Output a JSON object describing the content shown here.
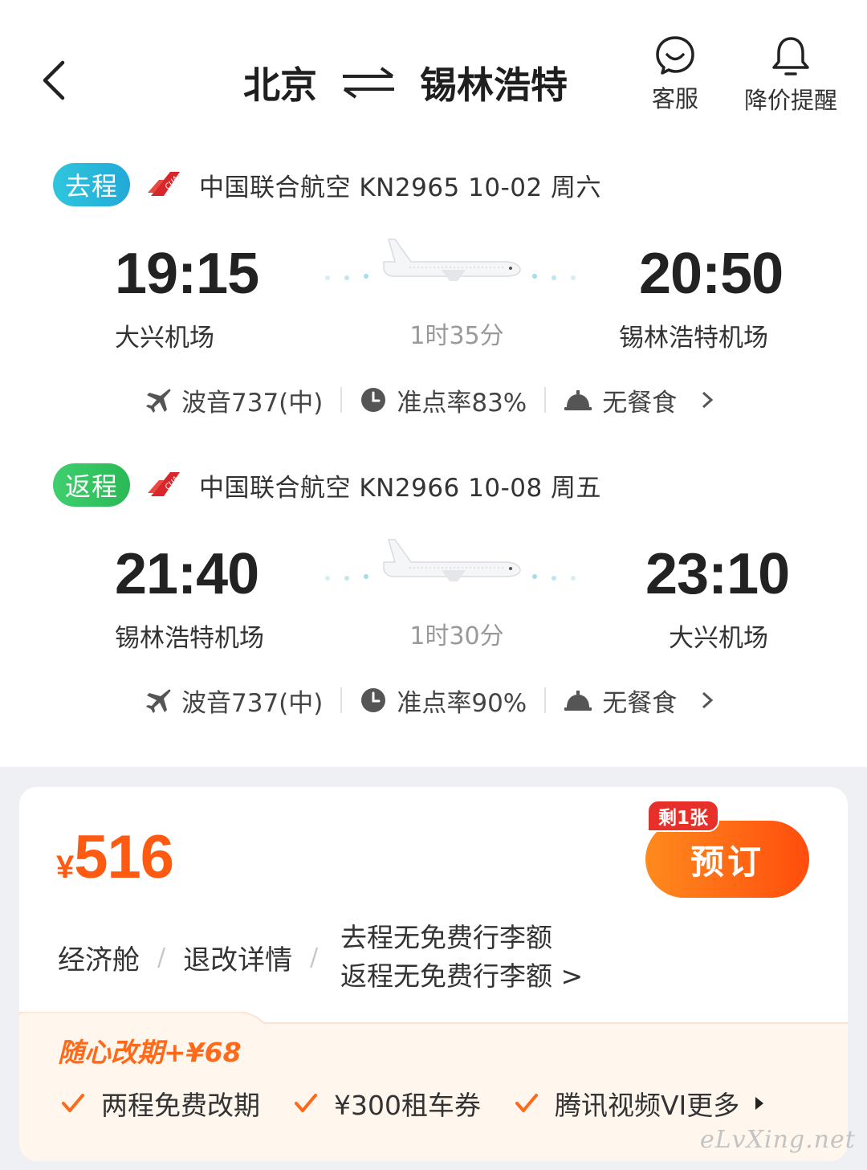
{
  "header": {
    "origin": "北京",
    "destination": "锡林浩特",
    "service_label": "客服",
    "alert_label": "降价提醒",
    "icons": [
      "back-icon",
      "swap-icon",
      "service-icon",
      "bell-icon"
    ]
  },
  "outbound": {
    "tag": "去程",
    "title": "中国联合航空 KN2965  10-02 周六",
    "dep_time": "19:15",
    "arr_time": "20:50",
    "dep_airport": "大兴机场",
    "arr_airport": "锡林浩特机场",
    "duration": "1时35分",
    "aircraft": "波音737(中)",
    "ontime": "准点率83%",
    "meal": "无餐食"
  },
  "return": {
    "tag": "返程",
    "title": "中国联合航空 KN2966  10-08 周五",
    "dep_time": "21:40",
    "arr_time": "23:10",
    "dep_airport": "锡林浩特机场",
    "arr_airport": "大兴机场",
    "duration": "1时30分",
    "aircraft": "波音737(中)",
    "ontime": "准点率90%",
    "meal": "无餐食"
  },
  "offer": {
    "currency": "¥",
    "price": "516",
    "remain_badge": "剩1张",
    "book_label": "预订",
    "cabin": "经济舱",
    "refund": "退改详情",
    "baggage_out": "去程无免费行李额",
    "baggage_ret": "返程无免费行李额 >",
    "promo_title": "随心改期+¥68",
    "perks": [
      "两程免费改期",
      "¥300租车券",
      "腾讯视频VI"
    ],
    "more_label": "更多"
  },
  "watermark": "eLvXing.net",
  "colors": {
    "accent": "#ff5a12",
    "go_tag": "#22a9d8",
    "return_tag": "#2bb956",
    "airline_red": "#d9262c"
  }
}
